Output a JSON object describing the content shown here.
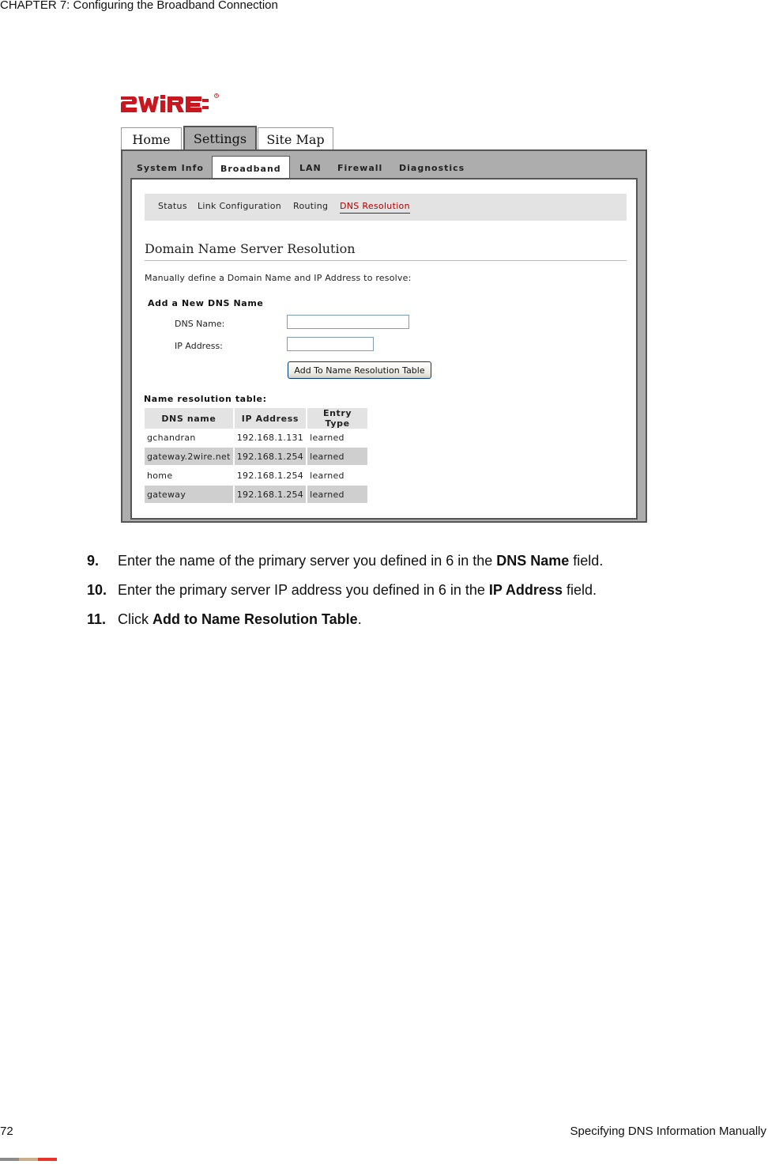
{
  "page_header": "CHAPTER 7: Configuring the Broadband Connection",
  "brand": {
    "name": "2wire",
    "color": "#c8171e"
  },
  "top_tabs": [
    {
      "label": "Home",
      "active": false
    },
    {
      "label": "Settings",
      "active": true
    },
    {
      "label": "Site Map",
      "active": false
    }
  ],
  "sub_tabs": [
    {
      "label": "System Info",
      "active": false
    },
    {
      "label": "Broadband",
      "active": true
    },
    {
      "label": "LAN",
      "active": false
    },
    {
      "label": "Firewall",
      "active": false
    },
    {
      "label": "Diagnostics",
      "active": false
    }
  ],
  "section_nav": [
    {
      "label": "Status",
      "active": false
    },
    {
      "label": "Link Configuration",
      "active": false
    },
    {
      "label": "Routing",
      "active": false
    },
    {
      "label": "DNS Resolution",
      "active": true
    }
  ],
  "panel": {
    "title": "Domain Name Server Resolution",
    "intro": "Manually define a Domain Name and IP Address to resolve:",
    "add_heading": "Add a New DNS Name",
    "dns_name_label": "DNS Name:",
    "dns_name_value": "",
    "ip_address_label": "IP Address:",
    "ip_address_value": "",
    "add_button": "Add To Name Resolution Table",
    "table_heading": "Name resolution table:",
    "table": {
      "columns": [
        "DNS name",
        "IP Address",
        "Entry Type"
      ],
      "rows": [
        [
          "gchandran",
          "192.168.1.131",
          "learned"
        ],
        [
          "gateway.2wire.net",
          "192.168.1.254",
          "learned"
        ],
        [
          "home",
          "192.168.1.254",
          "learned"
        ],
        [
          "gateway",
          "192.168.1.254",
          "learned"
        ]
      ]
    }
  },
  "steps": [
    {
      "num": "9.",
      "pre": "Enter the name of the primary server you defined in 6 in the ",
      "bold": "DNS Name",
      "post": " field."
    },
    {
      "num": "10.",
      "pre": "Enter the primary server IP address you defined in 6 in the ",
      "bold": "IP Address",
      "post": " field."
    },
    {
      "num": "11.",
      "pre": "Click ",
      "bold": "Add to Name Resolution Table",
      "post": "."
    }
  ],
  "footer": {
    "page_number": "72",
    "section_title": "Specifying DNS Information Manually",
    "bar_colors": [
      "#8c8c8c",
      "#c9ae88",
      "#e8332a"
    ]
  },
  "colors": {
    "frame_gray": "#adadad",
    "nav_bg": "#e3e3e3",
    "active_link": "#b00000",
    "row_alt": "#cfcfcf"
  }
}
